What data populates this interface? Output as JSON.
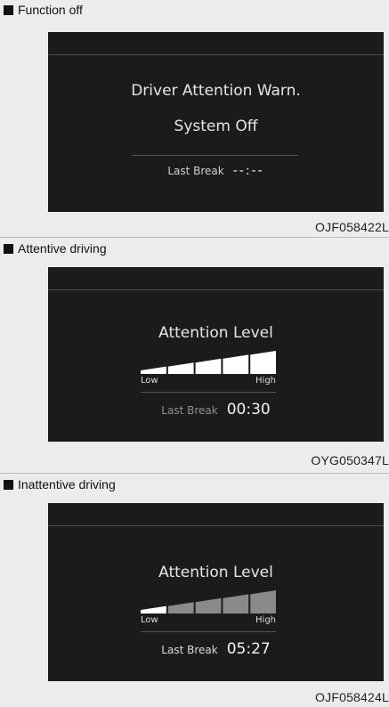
{
  "panels": [
    {
      "header": "Function off",
      "line1": "Driver Attention Warn.",
      "line2": "System Off",
      "last_break_label": "Last Break",
      "last_break_value": "--:--",
      "code": "OJF058422L"
    },
    {
      "header": "Attentive driving",
      "title": "Attention Level",
      "low_label": "Low",
      "high_label": "High",
      "last_break_label": "Last Break",
      "last_break_value": "00:30",
      "attention_level_segments": 5,
      "segments_total": 5,
      "code": "OYG050347L"
    },
    {
      "header": "Inattentive driving",
      "title": "Attention Level",
      "low_label": "Low",
      "high_label": "High",
      "last_break_label": "Last Break",
      "last_break_value": "05:27",
      "attention_level_segments": 1,
      "segments_total": 5,
      "code": "OJF058424L"
    }
  ],
  "colors": {
    "screen_bg": "#1b1b1b",
    "active_segment": "#ffffff",
    "inactive_segment": "#8a8a8a"
  }
}
